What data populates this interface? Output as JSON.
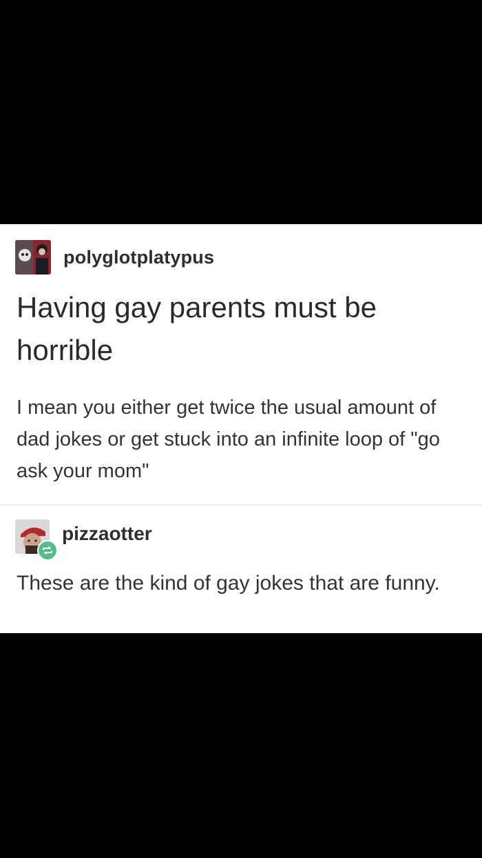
{
  "original_post": {
    "username": "polyglotplatypus",
    "avatar_icon": "user-avatar-icon",
    "title": "Having gay parents must be horrible",
    "body": "I mean you either get twice the usual amount of dad jokes or get stuck into an infinite loop of \"go ask your mom\""
  },
  "reblog": {
    "username": "pizzaotter",
    "avatar_icon": "user-avatar-icon",
    "badge_icon": "reblog-icon",
    "body": "These are the kind of gay jokes that are funny."
  },
  "colors": {
    "background": "#000000",
    "card": "#ffffff",
    "text": "#2b2b2b",
    "reblog_badge": "#56bc8a"
  }
}
